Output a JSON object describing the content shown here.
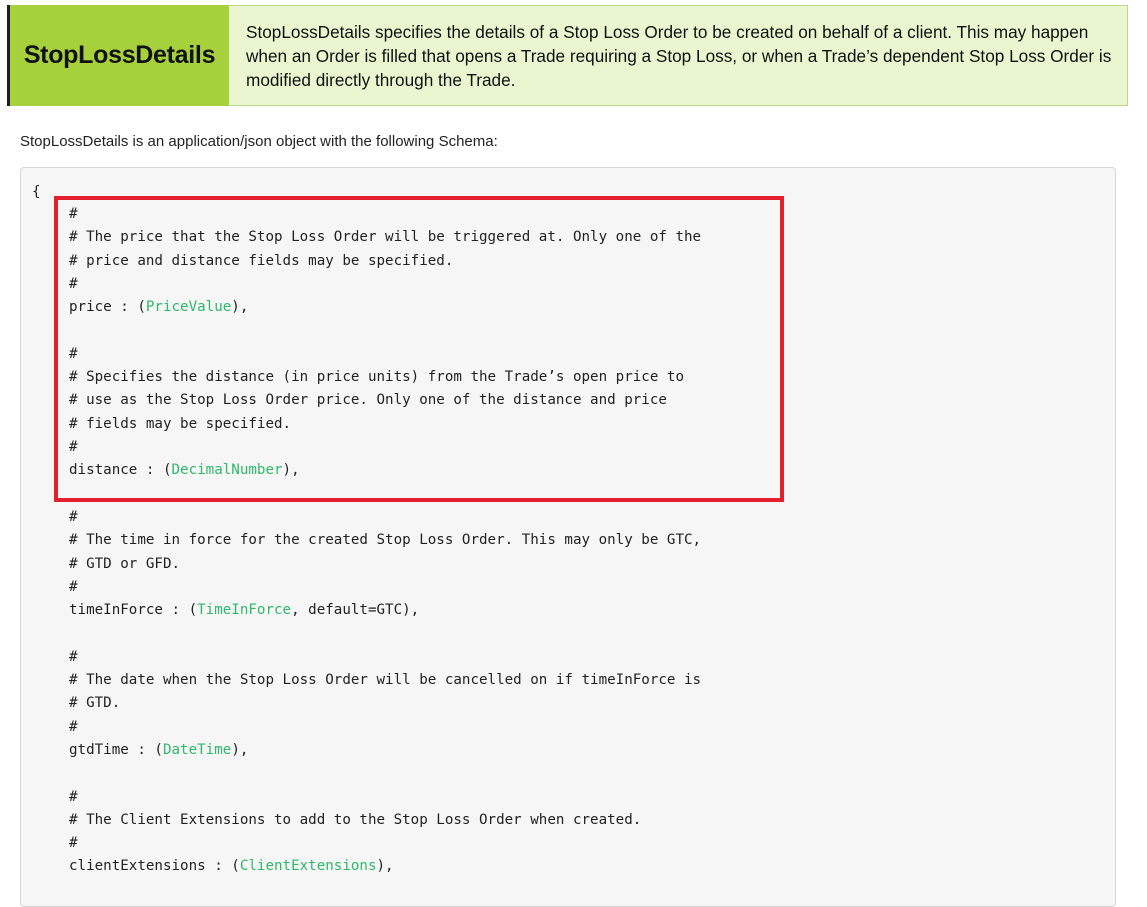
{
  "header": {
    "name": "StopLossDetails",
    "description": "StopLossDetails specifies the details of a Stop Loss Order to be created on behalf of a client. This may happen when an Order is filled that opens a Trade requiring a Stop Loss, or when a Trade’s dependent Stop Loss Order is modified directly through the Trade."
  },
  "intro": "StopLossDetails is an application/json object with the following Schema:",
  "colors": {
    "header_name_bg": "#a6d13d",
    "header_desc_bg": "#eaf6cf",
    "type_link": "#2eb86a",
    "highlight_box": "#e3202d"
  },
  "code": {
    "open_brace": "{",
    "fields": [
      {
        "comment": [
          "#",
          "# The price that the Stop Loss Order will be triggered at. Only one of the",
          "# price and distance fields may be specified.",
          "#"
        ],
        "name": "price",
        "type": "PriceValue",
        "suffix": ""
      },
      {
        "comment": [
          "#",
          "# Specifies the distance (in price units) from the Trade’s open price to",
          "# use as the Stop Loss Order price. Only one of the distance and price",
          "# fields may be specified.",
          "#"
        ],
        "name": "distance",
        "type": "DecimalNumber",
        "suffix": ""
      },
      {
        "comment": [
          "#",
          "# The time in force for the created Stop Loss Order. This may only be GTC,",
          "# GTD or GFD.",
          "#"
        ],
        "name": "timeInForce",
        "type": "TimeInForce",
        "suffix": ", default=GTC"
      },
      {
        "comment": [
          "#",
          "# The date when the Stop Loss Order will be cancelled on if timeInForce is",
          "# GTD.",
          "#"
        ],
        "name": "gtdTime",
        "type": "DateTime",
        "suffix": ""
      },
      {
        "comment": [
          "#",
          "# The Client Extensions to add to the Stop Loss Order when created.",
          "#"
        ],
        "name": "clientExtensions",
        "type": "ClientExtensions",
        "suffix": ""
      }
    ]
  }
}
